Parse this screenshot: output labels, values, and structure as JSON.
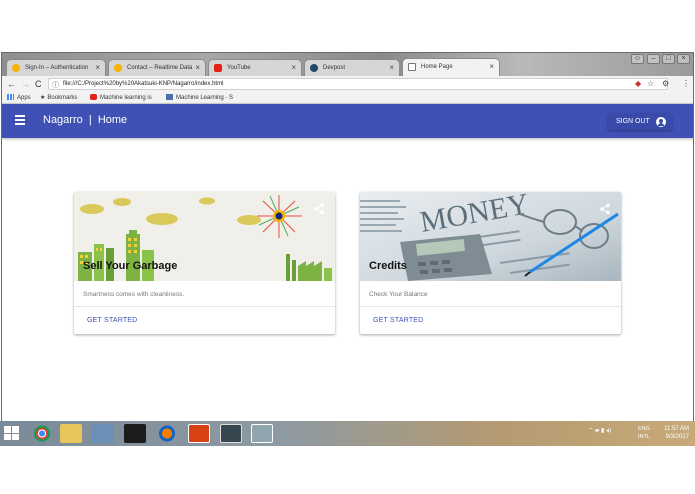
{
  "browser": {
    "tabs": [
      {
        "label": "Sign-In – Authentication",
        "favicon_color": "#f4b400",
        "active": false
      },
      {
        "label": "Contact – Realtime Data",
        "favicon_color": "#f4b400",
        "active": false
      },
      {
        "label": "YouTube",
        "favicon_color": "#e62117",
        "active": false
      },
      {
        "label": "Devpost",
        "favicon_color": "#1f4b66",
        "active": false
      },
      {
        "label": "Home Page",
        "favicon_color": "#ffffff",
        "active": true
      }
    ],
    "url": "file:///C:/Project%20by%20Akatsuki-KNP/Nagarro/index.html",
    "bookmarks": [
      {
        "label": "Apps"
      },
      {
        "label": "Bookmarks"
      },
      {
        "label": "Machine learning is"
      },
      {
        "label": "Machine Learning - S"
      }
    ]
  },
  "app": {
    "title": "Nagarro  |  Home",
    "signout_label": "SIGN OUT",
    "accent_color": "#3f51b5"
  },
  "cards": [
    {
      "title": "Sell Your Garbage",
      "text": "Smartness comes with cleanliness.",
      "action": "GET STARTED",
      "image": "city-illustration"
    },
    {
      "title": "Credits",
      "text": "Check Your Balance",
      "action": "GET STARTED",
      "image": "money-newspaper-photo"
    }
  ],
  "taskbar": {
    "language": "ENG\nINTL",
    "time": "11:57 AM",
    "date": "9/3/2017"
  }
}
